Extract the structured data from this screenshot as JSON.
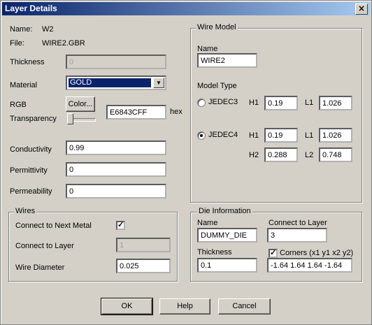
{
  "window": {
    "title": "Layer Details",
    "close_glyph": "×"
  },
  "left": {
    "name_label": "Name:",
    "name_value": "W2",
    "file_label": "File:",
    "file_value": "WIRE2.GBR",
    "thickness_label": "Thickness",
    "thickness_value": "0",
    "material_label": "Material",
    "material_value": "GOLD",
    "rgb_label": "RGB",
    "color_button": "Color...",
    "transparency_label": "Transparency",
    "hex_value": "E6843CFF",
    "hex_label": "hex",
    "conductivity_label": "Conductivity",
    "conductivity_value": "0.99",
    "permittivity_label": "Permittivity",
    "permittivity_value": "0",
    "permeability_label": "Permeability",
    "permeability_value": "0"
  },
  "wires": {
    "title": "Wires",
    "connect_next_label": "Connect to Next Metal",
    "connect_next_checked": "✓",
    "connect_layer_label": "Connect to Layer",
    "connect_layer_value": "1",
    "diameter_label": "Wire Diameter",
    "diameter_value": "0.025"
  },
  "wire_model": {
    "title": "Wire Model",
    "name_label": "Name",
    "name_value": "WIRE2",
    "model_type_label": "Model Type",
    "jedec3": {
      "label": "JEDEC3",
      "h1_label": "H1",
      "h1_value": "0.19",
      "l1_label": "L1",
      "l1_value": "1.026"
    },
    "jedec4": {
      "label": "JEDEC4",
      "h1_label": "H1",
      "h1_value": "0.19",
      "l1_label": "L1",
      "l1_value": "1.026",
      "h2_label": "H2",
      "h2_value": "0.288",
      "l2_label": "L2",
      "l2_value": "0.748"
    }
  },
  "die": {
    "title": "Die Information",
    "name_label": "Name",
    "name_value": "DUMMY_DIE",
    "connect_label": "Connect to Layer",
    "connect_value": "3",
    "thickness_label": "Thickness",
    "thickness_value": "0.1",
    "corners_label": "Corners (x1 y1 x2 y2)",
    "corners_checked": "✓",
    "corners_value": "-1.64 1.64 1.64 -1.64"
  },
  "buttons": {
    "ok": "OK",
    "help": "Help",
    "cancel": "Cancel"
  },
  "icons": {
    "dropdown_arrow": "▼"
  }
}
